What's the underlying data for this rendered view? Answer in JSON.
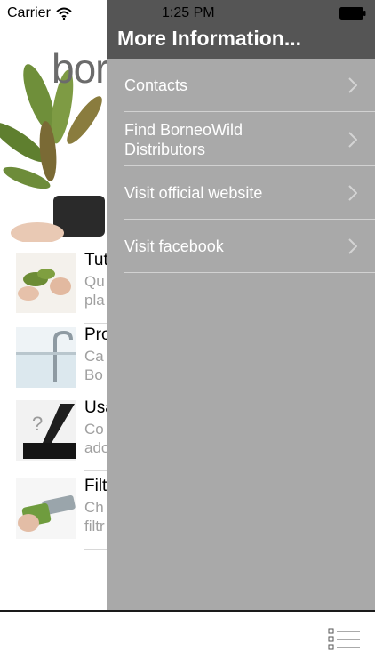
{
  "status_bar": {
    "carrier": "Carrier",
    "time": "1:25 PM"
  },
  "background": {
    "logo_text": "bor",
    "rows": [
      {
        "title": "Tut",
        "subtitle_lines": [
          "Qu",
          "pla"
        ]
      },
      {
        "title": "Pro",
        "subtitle_lines": [
          "Ca",
          "Bo"
        ]
      },
      {
        "title": "Usa",
        "subtitle_lines": [
          "Co",
          "ado"
        ]
      },
      {
        "title": "Filt",
        "subtitle_lines": [
          "Ch",
          "filtr"
        ]
      }
    ]
  },
  "drawer": {
    "title": "More Information...",
    "items": [
      {
        "label": "Contacts"
      },
      {
        "label": "Find BorneoWild Distributors"
      },
      {
        "label": "Visit official website"
      },
      {
        "label": "Visit facebook"
      }
    ]
  },
  "colors": {
    "drawer_header": "#555555",
    "drawer_body": "#a9a9a9",
    "divider": "#d2d2d2"
  },
  "icons": {
    "wifi": "wifi-icon",
    "battery": "battery-icon",
    "chevron": "chevron-right-icon",
    "menu": "list-menu-icon"
  }
}
